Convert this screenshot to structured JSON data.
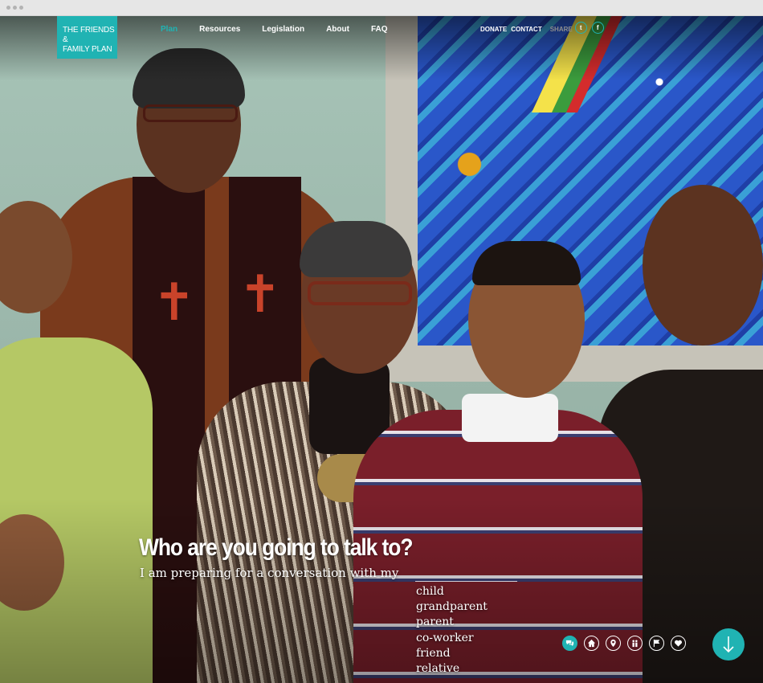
{
  "logo": {
    "line1": "THE FRIENDS &",
    "line2": "FAMILY PLAN"
  },
  "nav": {
    "items": [
      {
        "label": "Plan",
        "active": true
      },
      {
        "label": "Resources",
        "active": false
      },
      {
        "label": "Legislation",
        "active": false
      },
      {
        "label": "About",
        "active": false
      },
      {
        "label": "FAQ",
        "active": false
      }
    ]
  },
  "utility_nav": {
    "donate": "DONATE",
    "contact": "CONTACT",
    "share": "SHARE"
  },
  "social": {
    "twitter": "t",
    "facebook": "f"
  },
  "hero": {
    "headline": "Who are you going to talk to?",
    "subline": "I am preparing for a conversation with my",
    "options": [
      "child",
      "grandparent",
      "parent",
      "co-worker",
      "friend",
      "relative"
    ]
  },
  "section_icons": [
    {
      "name": "conversation-icon",
      "active": true
    },
    {
      "name": "home-icon",
      "active": false
    },
    {
      "name": "location-pin-icon",
      "active": false
    },
    {
      "name": "people-icon",
      "active": false
    },
    {
      "name": "flag-icon",
      "active": false
    },
    {
      "name": "heart-icon",
      "active": false
    }
  ],
  "colors": {
    "accent": "#20b3b3",
    "nav_text": "#ffffff",
    "share_text": "#8e8e8e"
  }
}
